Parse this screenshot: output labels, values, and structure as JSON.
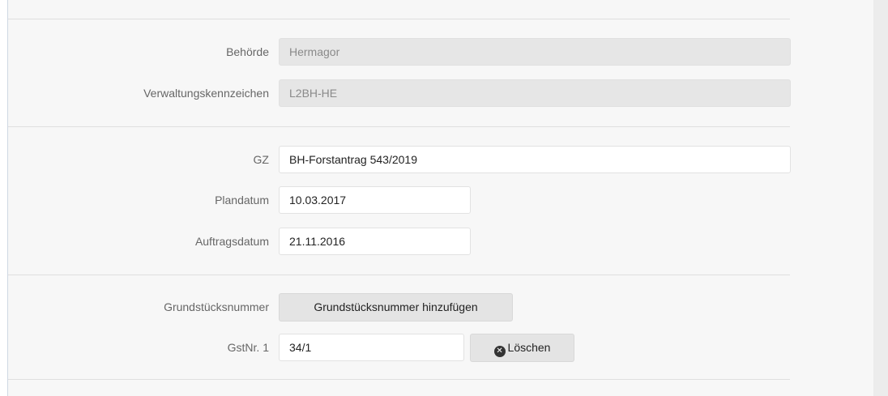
{
  "authority": {
    "behoerde_label": "Behörde",
    "behoerde_value": "Hermagor",
    "verwaltungskennzeichen_label": "Verwaltungskennzeichen",
    "verwaltungskennzeichen_value": "L2BH-HE"
  },
  "details": {
    "gz_label": "GZ",
    "gz_value": "BH-Forstantrag 543/2019",
    "plandatum_label": "Plandatum",
    "plandatum_value": "10.03.2017",
    "auftragsdatum_label": "Auftragsdatum",
    "auftragsdatum_value": "21.11.2016"
  },
  "parcels": {
    "grundstuecksnummer_label": "Grundstücksnummer",
    "add_button_label": "Grundstücksnummer hinzufügen",
    "items": [
      {
        "label": "GstNr. 1",
        "value": "34/1",
        "delete_label": "Löschen",
        "delete_icon": "times-circle-icon"
      }
    ]
  }
}
